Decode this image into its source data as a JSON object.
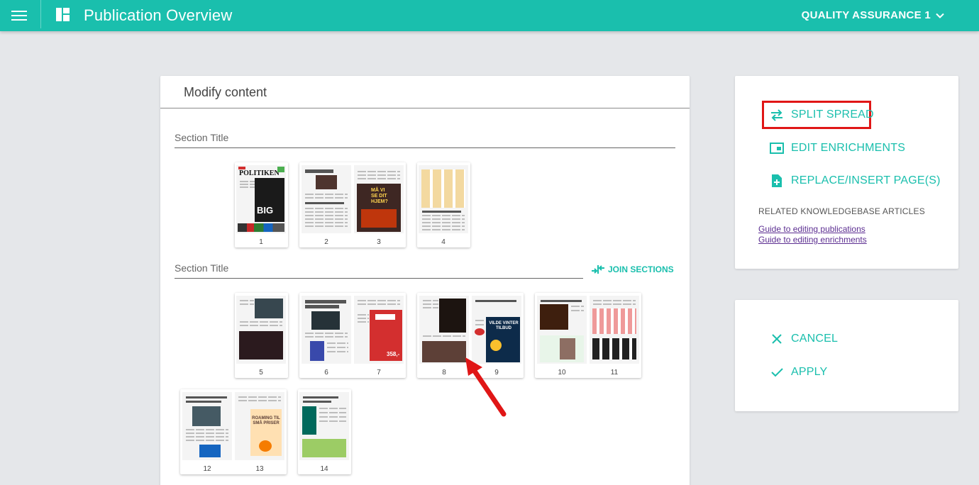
{
  "header": {
    "title": "Publication Overview",
    "account": "QUALITY ASSURANCE 1"
  },
  "modify_card": {
    "title": "Modify content",
    "sections": [
      {
        "title": "Section Title",
        "pages": [
          "1",
          "2",
          "3",
          "4"
        ]
      },
      {
        "title": "Section Title",
        "join_label": "JOIN SECTIONS",
        "pages": [
          "5",
          "6",
          "7",
          "8",
          "9",
          "10",
          "11",
          "12",
          "13",
          "14"
        ]
      }
    ],
    "page_text": {
      "p1_masthead": "POLITIKEN",
      "p1_cover": "BIG",
      "p3_ad": "MÅ VI SE DIT HJEM?",
      "p7_ad": "358,-",
      "p9_ad": "VILDE VINTER TILBUD",
      "p9_price": "1499,-",
      "p13_ad": "ROAMING TIL SMÅ PRISER"
    }
  },
  "actions_card": {
    "split": "SPLIT SPREAD",
    "enrich": "EDIT ENRICHMENTS",
    "replace": "REPLACE/INSERT PAGE(S)",
    "kb_heading": "RELATED KNOWLEDGEBASE ARTICLES",
    "kb_links": [
      "Guide to editing publications",
      "Guide to editing enrichments"
    ]
  },
  "confirm_card": {
    "cancel": "CANCEL",
    "apply": "APPLY"
  },
  "colors": {
    "accent": "#1abfad",
    "highlight": "#e01616",
    "link": "#5c2e91"
  }
}
